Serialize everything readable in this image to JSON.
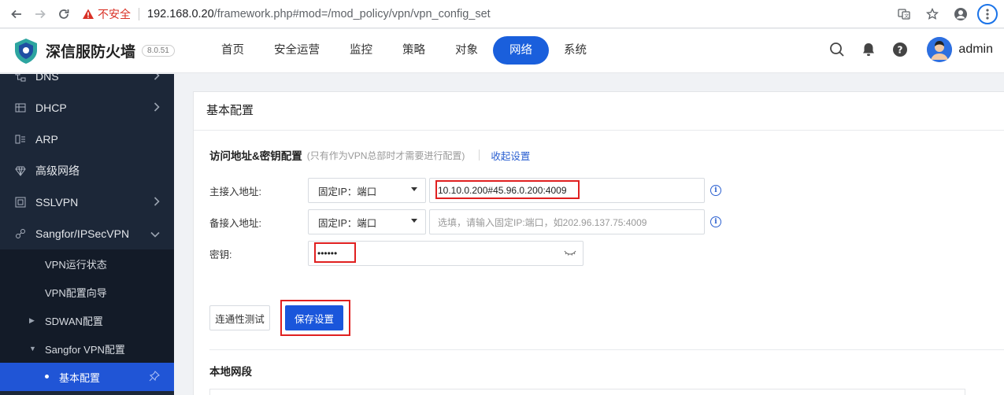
{
  "browser": {
    "insecure_label": "不安全",
    "url_host": "192.168.0.20",
    "url_path": "/framework.php#mod=/mod_policy/vpn/vpn_config_set"
  },
  "header": {
    "brand": "深信服防火墙",
    "version": "8.0.51",
    "nav": [
      "首页",
      "安全运营",
      "监控",
      "策略",
      "对象",
      "网络",
      "系统"
    ],
    "active_nav": "网络",
    "username": "admin"
  },
  "sidebar": {
    "items": [
      {
        "label": "DNS",
        "icon": "dns-icon"
      },
      {
        "label": "DHCP",
        "icon": "dhcp-icon"
      },
      {
        "label": "ARP",
        "icon": "arp-icon"
      },
      {
        "label": "高级网络",
        "icon": "advanced-network-icon"
      },
      {
        "label": "SSLVPN",
        "icon": "sslvpn-icon"
      },
      {
        "label": "Sangfor/IPSecVPN",
        "icon": "ipsec-vpn-icon"
      }
    ],
    "sub": [
      "VPN运行状态",
      "VPN配置向导",
      "SDWAN配置",
      "Sangfor VPN配置",
      "基本配置"
    ]
  },
  "panel": {
    "title": "基本配置",
    "section_title": "访问地址&密钥配置",
    "section_note": "(只有作为VPN总部时才需要进行配置)",
    "collapse_link": "收起设置",
    "primary_label": "主接入地址:",
    "primary_select": "固定IP：端口",
    "primary_value": "10.10.0.200#45.96.0.200:4009",
    "backup_label": "备接入地址:",
    "backup_select": "固定IP：端口",
    "backup_placeholder": "选填，请输入固定IP:端口，如202.96.137.75:4009",
    "key_label": "密钥:",
    "key_value": "••••••",
    "test_button": "连通性测试",
    "save_button": "保存设置",
    "local_segment_title": "本地网段"
  }
}
